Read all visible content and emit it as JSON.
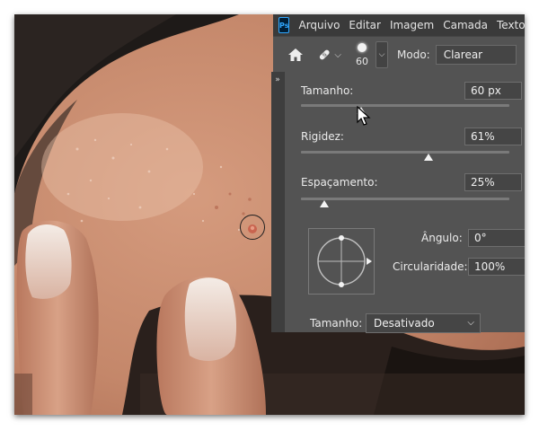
{
  "menubar": {
    "logo": "Ps",
    "items": [
      "Arquivo",
      "Editar",
      "Imagem",
      "Camada",
      "Texto"
    ]
  },
  "options": {
    "brush_size": "60",
    "mode_label": "Modo:",
    "mode_value": "Clarear"
  },
  "panel": {
    "tamanho": {
      "label": "Tamanho:",
      "value": "60 px",
      "position": 0.29
    },
    "rigidez": {
      "label": "Rigidez:",
      "value": "61%",
      "position": 0.61
    },
    "espacamento": {
      "label": "Espaçamento:",
      "value": "25%",
      "position": 0.11
    },
    "angulo": {
      "label": "Ângulo:",
      "value": "0°"
    },
    "circularidade": {
      "label": "Circularidade:",
      "value": "100%"
    },
    "tamanho_control": {
      "label": "Tamanho:",
      "value": "Desativado"
    }
  },
  "icons": {
    "home": "home-icon",
    "spot_healing": "spot-healing-brush-icon",
    "collapse": "collapse-arrows-icon"
  },
  "colors": {
    "panel_bg": "#535353",
    "menubar_bg": "#3a3a3a",
    "ps_blue": "#31a8ff"
  }
}
